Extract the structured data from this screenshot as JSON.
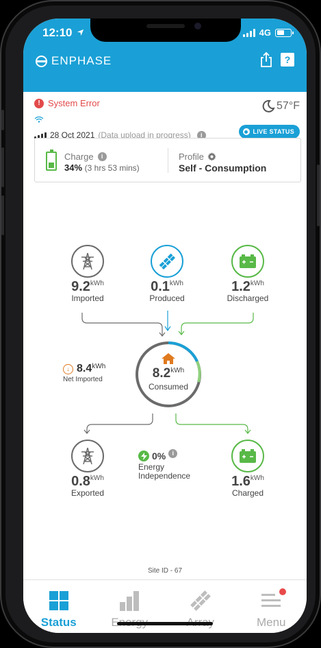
{
  "status_bar": {
    "time": "12:10",
    "network": "4G"
  },
  "header": {
    "brand": "ENPHASE",
    "share_icon": "share-icon",
    "help_label": "?"
  },
  "system": {
    "error_text": "System Error",
    "temperature": "57°F",
    "date": "28 Oct 2021",
    "upload_note": "(Data upload in progress)",
    "live_status": "LIVE STATUS"
  },
  "card": {
    "charge_label": "Charge",
    "charge_percent": "34%",
    "charge_percent_value": 34,
    "charge_time": "(3 hrs 53 mins)",
    "profile_label": "Profile",
    "profile_value": "Self - Consumption"
  },
  "flow": {
    "unit": "kWh",
    "imported": {
      "value": "9.2",
      "label": "Imported"
    },
    "produced": {
      "value": "0.1",
      "label": "Produced"
    },
    "discharged": {
      "value": "1.2",
      "label": "Discharged"
    },
    "consumed": {
      "value": "8.2",
      "label": "Consumed"
    },
    "net_imported": {
      "value": "8.4",
      "label": "Net Imported"
    },
    "exported": {
      "value": "0.8",
      "label": "Exported"
    },
    "charged": {
      "value": "1.6",
      "label": "Charged"
    },
    "energy_independence": {
      "value": "0%",
      "label_line1": "Energy",
      "label_line2": "Independence"
    }
  },
  "site_id": "Site ID - 67",
  "tabs": [
    {
      "label": "Status",
      "icon": "grid-icon",
      "active": true
    },
    {
      "label": "Energy",
      "icon": "bar-chart-icon",
      "active": false
    },
    {
      "label": "Array",
      "icon": "solar-array-icon",
      "active": false
    },
    {
      "label": "Menu",
      "icon": "menu-icon",
      "active": false
    }
  ],
  "colors": {
    "brand_blue": "#1aa0d6",
    "grid_gray": "#6b6b6b",
    "battery_green": "#58b947",
    "home_orange": "#e07a1f",
    "error_red": "#e34a4a"
  }
}
